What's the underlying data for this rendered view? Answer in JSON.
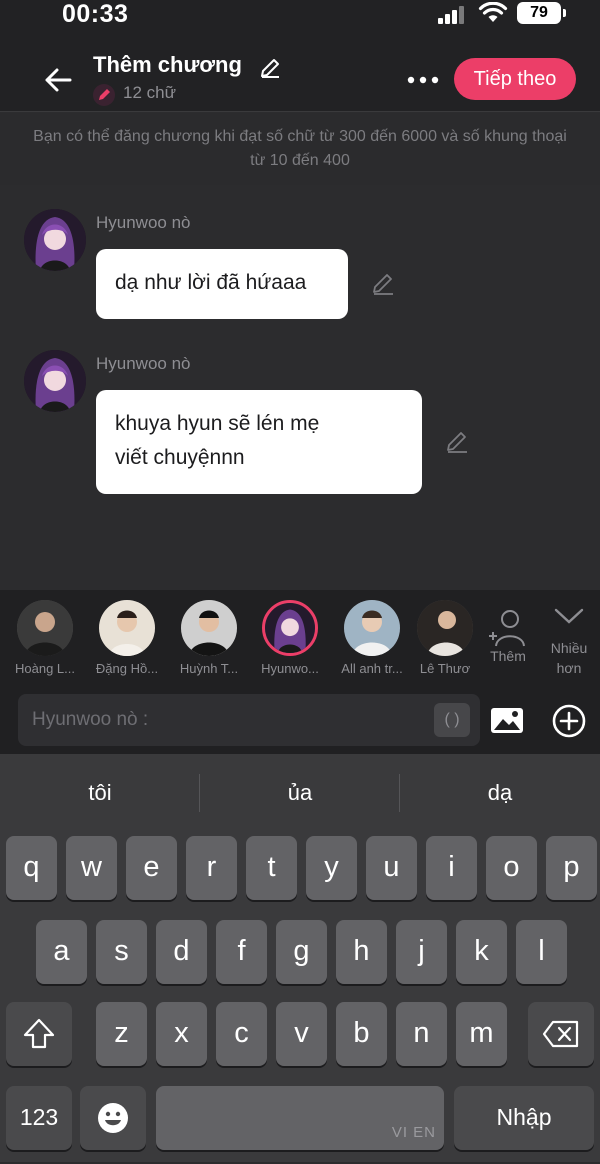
{
  "status": {
    "time": "00:33",
    "battery": "79"
  },
  "header": {
    "title": "Thêm chương",
    "word_count": "12 chữ",
    "next_label": "Tiếp theo"
  },
  "notice": "Bạn có thể đăng chương khi đạt số chữ từ 300 đến 6000 và số khung thoại từ 10 đến 400",
  "messages": [
    {
      "sender": "Hyunwoo nò",
      "text": "dạ như lời đã hứaaa"
    },
    {
      "sender": "Hyunwoo nò",
      "text_lines": [
        "khuya hyun sẽ lén mẹ",
        "viết chuyệnnn"
      ]
    }
  ],
  "characters": [
    {
      "name": "Hoàng L..."
    },
    {
      "name": "Đặng Hồ..."
    },
    {
      "name": "Huỳnh T..."
    },
    {
      "name": "Hyunwo..."
    },
    {
      "name": "All anh tr..."
    },
    {
      "name": "Lê Thươ"
    }
  ],
  "add_character_label": "Thêm",
  "more_label_lines": [
    "Nhiều",
    "hơn"
  ],
  "input": {
    "placeholder": "Hyunwoo nò :",
    "paren": "( )"
  },
  "keyboard": {
    "suggestions": [
      "tôi",
      "ủa",
      "dạ"
    ],
    "row1": [
      "q",
      "w",
      "e",
      "r",
      "t",
      "y",
      "u",
      "i",
      "o",
      "p"
    ],
    "row2": [
      "a",
      "s",
      "d",
      "f",
      "g",
      "h",
      "j",
      "k",
      "l"
    ],
    "row3": [
      "z",
      "x",
      "c",
      "v",
      "b",
      "n",
      "m"
    ],
    "numbers_key": "123",
    "space_hint": "VI EN",
    "return_key": "Nhập"
  },
  "colors": {
    "accent": "#ec3e68",
    "bubble": "#ffffff",
    "background": "#2c2c2e"
  }
}
